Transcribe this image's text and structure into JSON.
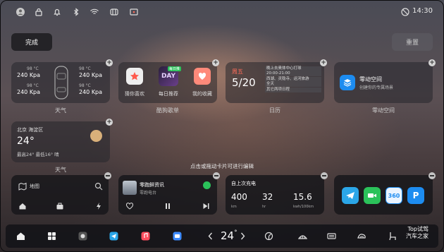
{
  "status_bar": {
    "time": "14:30",
    "icons": [
      "avatar-icon",
      "lock-icon",
      "bell-icon",
      "bluetooth-icon",
      "wifi-icon",
      "seat-vent-icon",
      "screen-cast-icon",
      "no-disturb-icon"
    ]
  },
  "toolbar": {
    "done_label": "完成",
    "reset_label": "重置"
  },
  "weather_tyre_card": {
    "caption": "天气",
    "tyres": [
      {
        "temp": "98 °C",
        "pressure": "240 Kpa"
      },
      {
        "temp": "98 °C",
        "pressure": "240 Kpa"
      },
      {
        "temp": "98 °C",
        "pressure": "240 Kpa"
      },
      {
        "temp": "98 °C",
        "pressure": "240 Kpa"
      }
    ]
  },
  "music_card": {
    "caption": "酷狗歌单",
    "badge": "每日推",
    "items": [
      {
        "label": "猜你喜欢"
      },
      {
        "label": "每日推荐"
      },
      {
        "label": "我的收藏"
      }
    ]
  },
  "calendar_card": {
    "caption": "日历",
    "weekday": "周五",
    "date": "5/20",
    "events": [
      {
        "title": "晚上去奥体中心打球",
        "time": "20:00-21:00"
      },
      {
        "title": "西湖、灵隐寺、运河旅游",
        "time": "全天"
      },
      {
        "title": "其它两项日程",
        "time": ""
      }
    ]
  },
  "zero_space_card": {
    "caption": "零动空间",
    "title": "零动空间",
    "subtitle": "创建你的专属场景"
  },
  "location_weather_card": {
    "caption": "天气",
    "location": "北京 海淀区",
    "temp": "24°",
    "detail": "最高24° 最低16° 晴"
  },
  "edit_hint": "点击或拖动卡片可进行编辑",
  "map_card": {
    "label": "地图",
    "shortcuts": [
      "home-icon",
      "work-icon",
      "charge-icon"
    ]
  },
  "radio_card": {
    "title": "零跑鲜资讯",
    "subtitle": "零跑电台"
  },
  "charge_card": {
    "title": "自上次充电",
    "stats": [
      {
        "value": "400",
        "unit": "km"
      },
      {
        "value": "32",
        "unit": "hr"
      },
      {
        "value": "15.6",
        "unit": "kwh/100km"
      }
    ]
  },
  "apps_card": {
    "apps": [
      "telegram-app-icon",
      "facetime-app-icon",
      "360-app-icon",
      "parking-app-icon"
    ],
    "app_360_label": "360"
  },
  "dock": {
    "temperature": "24",
    "temp_unit": "°",
    "items": [
      "home-icon",
      "apps-grid-icon",
      "camera-app-icon",
      "messenger-app-icon",
      "music-app-icon",
      "video-app-icon",
      "fan-auto-icon",
      "defrost-front-icon",
      "defrost-rear-icon",
      "recirculation-icon",
      "seat-heat-icon"
    ]
  },
  "watermark": {
    "line1": "Top试驾",
    "line2": "汽车之家"
  },
  "colors": {
    "accent_red": "#ff6d5a",
    "blue_app": "#1d8cf0",
    "green_app": "#2bc25a",
    "gold_sun": "#d9b07a"
  }
}
